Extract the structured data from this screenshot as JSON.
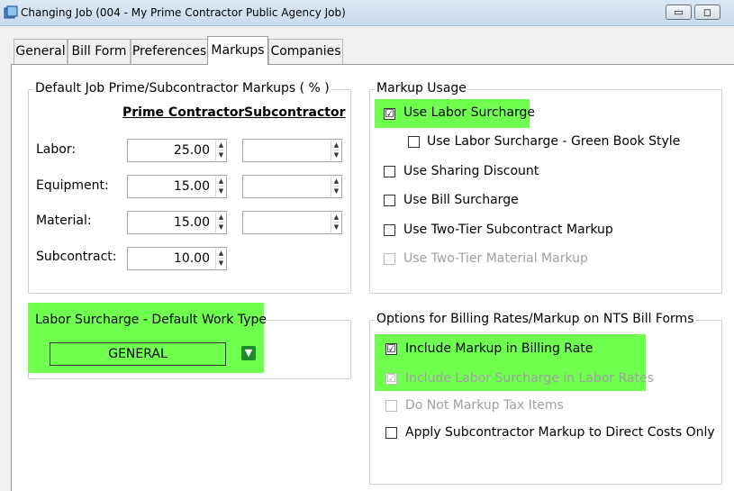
{
  "window": {
    "title": "Changing Job  (004 - My Prime Contractor Public Agency Job)",
    "icons": [
      "app-icon",
      "minimize-icon",
      "restore-icon",
      "close-icon"
    ]
  },
  "tabs": [
    {
      "label": "General",
      "active": false
    },
    {
      "label": "Bill Form",
      "active": false
    },
    {
      "label": "Preferences",
      "active": false
    },
    {
      "label": "Markups",
      "active": true
    },
    {
      "label": "Companies",
      "active": false
    }
  ],
  "markups_group": {
    "legend": "Default Job Prime/Subcontractor Markups ( % )",
    "col_prime": "Prime Contractor",
    "col_sub": "Subcontractor",
    "rows": [
      {
        "label": "Labor:",
        "prime": "25.00",
        "sub": ""
      },
      {
        "label": "Equipment:",
        "prime": "15.00",
        "sub": ""
      },
      {
        "label": "Material:",
        "prime": "15.00",
        "sub": ""
      },
      {
        "label": "Subcontract:",
        "prime": "10.00"
      }
    ]
  },
  "worktype_group": {
    "legend": "Labor Surcharge - Default Work Type",
    "value": "GENERAL"
  },
  "usage_group": {
    "legend": "Markup Usage",
    "items": [
      {
        "label": "Use Labor Surcharge",
        "checked": "☑",
        "enabled": true
      },
      {
        "label": "Use Labor Surcharge - Green Book Style",
        "checked": "",
        "enabled": true
      },
      {
        "label": "Use Sharing Discount",
        "checked": "",
        "enabled": true
      },
      {
        "label": "Use Bill Surcharge",
        "checked": "",
        "enabled": true
      },
      {
        "label": "Use Two-Tier Subcontract Markup",
        "checked": "",
        "enabled": true
      },
      {
        "label": "Use Two-Tier Material Markup",
        "checked": "",
        "enabled": false
      }
    ]
  },
  "billing_group": {
    "legend": "Options for Billing Rates/Markup on NTS Bill Forms",
    "items": [
      {
        "label": "Include Markup in Billing Rate",
        "checked": "☑",
        "enabled": true
      },
      {
        "label": "Include Labor Surcharge in Labor Rates",
        "checked": "☑",
        "enabled": false
      },
      {
        "label": "Do Not Markup Tax Items",
        "checked": "",
        "enabled": false
      },
      {
        "label": "Apply Subcontractor Markup to Direct Costs Only",
        "checked": "",
        "enabled": true
      }
    ]
  },
  "colors": {
    "highlight": "#6fff4f",
    "dropdown_button": "#1a8a2b"
  }
}
